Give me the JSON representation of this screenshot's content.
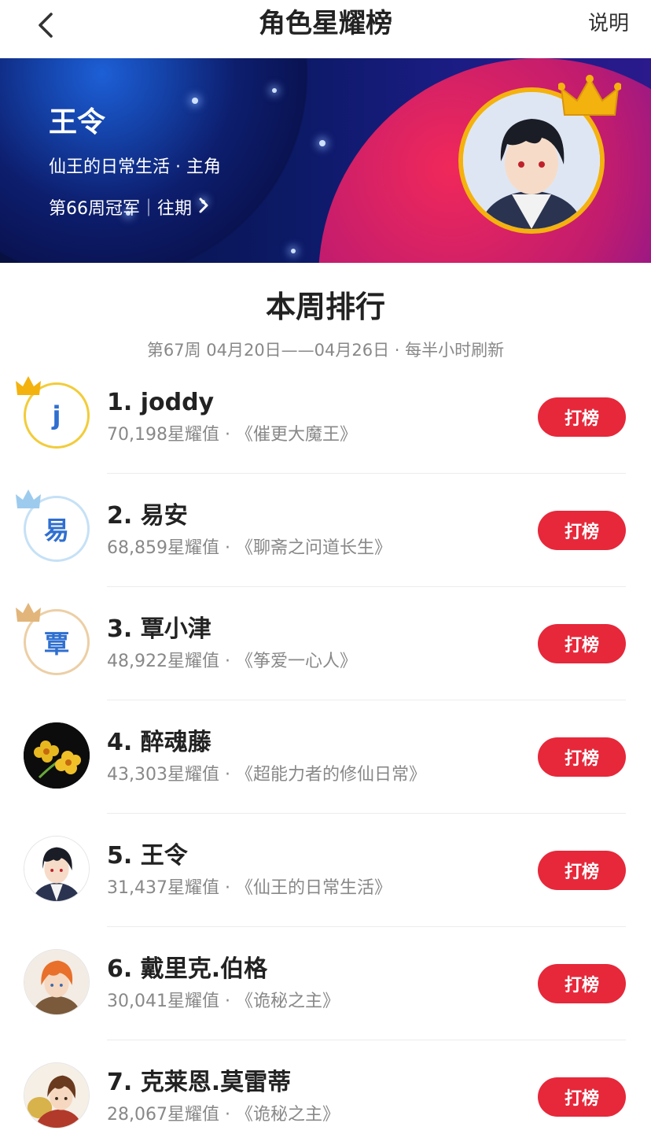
{
  "nav": {
    "title": "角色星耀榜",
    "help": "说明",
    "back_icon": "chevron-left-icon"
  },
  "banner": {
    "name": "王令",
    "work": "仙王的日常生活 · 主角",
    "champion_text": "第66周冠军｜往期",
    "crown_color": "#f4b20e"
  },
  "section": {
    "title": "本周排行",
    "subtitle": "第67周 04月20日——04月26日 · 每半小时刷新"
  },
  "ranking": [
    {
      "rank_name": "1. joddy",
      "meta": "70,198星耀值 · 《催更大魔王》",
      "avatar_text": "j",
      "avatar_style": "gold",
      "vote": "打榜"
    },
    {
      "rank_name": "2. 易安",
      "meta": "68,859星耀值 · 《聊斋之问道长生》",
      "avatar_text": "易",
      "avatar_style": "silver",
      "vote": "打榜"
    },
    {
      "rank_name": "3. 覃小津",
      "meta": "48,922星耀值 · 《筝爱一心人》",
      "avatar_text": "覃",
      "avatar_style": "bronze",
      "vote": "打榜"
    },
    {
      "rank_name": "4. 醉魂藤",
      "meta": "43,303星耀值 · 《超能力者的修仙日常》",
      "avatar_text": "",
      "avatar_style": "flower",
      "vote": "打榜"
    },
    {
      "rank_name": "5. 王令",
      "meta": "31,437星耀值 · 《仙王的日常生活》",
      "avatar_text": "",
      "avatar_style": "boy",
      "vote": "打榜"
    },
    {
      "rank_name": "6. 戴里克.伯格",
      "meta": "30,041星耀值 · 《诡秘之主》",
      "avatar_text": "",
      "avatar_style": "orange-hair",
      "vote": "打榜"
    },
    {
      "rank_name": "7. 克莱恩.莫雷蒂",
      "meta": "28,067星耀值 · 《诡秘之主》",
      "avatar_text": "",
      "avatar_style": "brown-hair",
      "vote": "打榜"
    }
  ],
  "colors": {
    "accent_red": "#e6283a",
    "gold": "#f4b20e",
    "silver": "#9dcbee",
    "bronze": "#e2b57a"
  }
}
